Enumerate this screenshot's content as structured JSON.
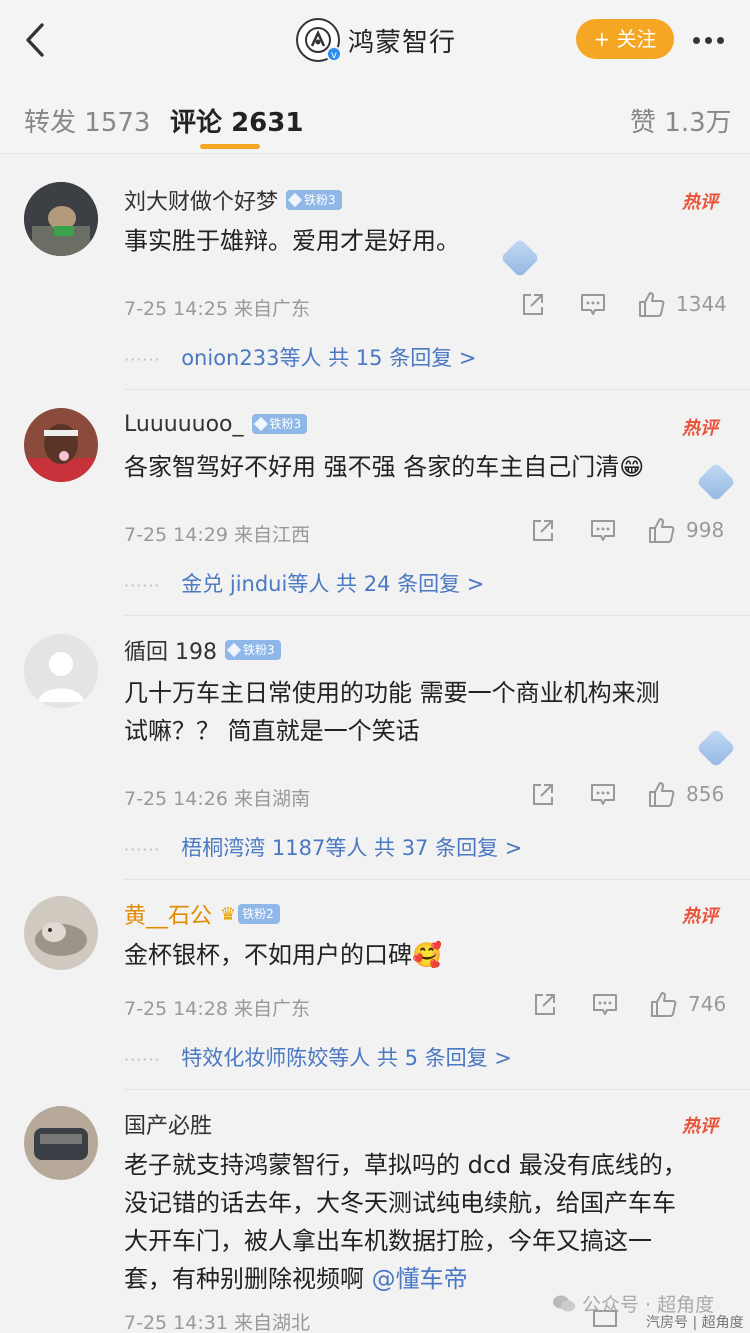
{
  "header": {
    "title": "鸿蒙智行",
    "follow_label": "+ 关注",
    "icons": {
      "back": "chevron-left-icon",
      "more": "more-dots-icon",
      "verified": "verified-badge-icon"
    }
  },
  "tabs": [
    {
      "label": "转发",
      "count": "1573"
    },
    {
      "label": "评论",
      "count": "2631"
    },
    {
      "label": "赞",
      "count": "1.3万"
    }
  ],
  "colors": {
    "accent": "#f5a623",
    "link": "#4a78c2",
    "hot": "#e8543a",
    "fan_badge": "#8fb8e8"
  },
  "comments": [
    {
      "user": "刘大财做个好梦",
      "badge": "铁粉3",
      "hot": "热评",
      "text": "事实胜于雄辩。爱用才是好用。",
      "time": "7-25 14:25",
      "location": "来自广东",
      "likes": "1344",
      "reply_users": "onion233",
      "reply_mid": "等人",
      "reply_count": "共 15 条回复 >"
    },
    {
      "user": "Luuuuuoo_",
      "badge": "铁粉3",
      "hot": "热评",
      "text": "各家智驾好不好用 强不强 各家的车主自己门清😁",
      "time": "7-25 14:29",
      "location": "来自江西",
      "likes": "998",
      "reply_users": "金兑 jindui",
      "reply_mid": "等人",
      "reply_count": "共 24 条回复 >"
    },
    {
      "user": "循回 198",
      "badge": "铁粉3",
      "hot": "",
      "text_line1": "几十万车主日常使用的功能  需要一个商业机构来测",
      "text_line2": "试嘛？？    简直就是一个笑话",
      "time": "7-25 14:26",
      "location": "来自湖南",
      "likes": "856",
      "reply_users": "梧桐湾湾 1187",
      "reply_mid": "等人",
      "reply_count": "共 37 条回复 >"
    },
    {
      "user": "黄__石公",
      "badge": "铁粉2",
      "hot": "热评",
      "text": "金杯银杯，不如用户的口碑🥰",
      "time": "7-25 14:28",
      "location": "来自广东",
      "likes": "746",
      "reply_users": "特效化妆师陈姣",
      "reply_mid": "等人",
      "reply_count": "共 5 条回复 >"
    },
    {
      "user": "国产必胜",
      "badge": "",
      "hot": "热评",
      "text_line1": "老子就支持鸿蒙智行，草拟吗的 dcd 最没有底线的，",
      "text_line2": "没记错的话去年，大冬天测试纯电续航，给国产车车",
      "text_line3": "大开车门，被人拿出车机数据打脸，今年又搞这一",
      "text_line4": "套，有种别删除视频啊 ",
      "mention": "@懂车帝",
      "time": "7-25 14:31",
      "location": "来自湖北"
    }
  ],
  "watermark": "公众号 · 超角度",
  "watermark_small": "汽房号 | 超角度"
}
